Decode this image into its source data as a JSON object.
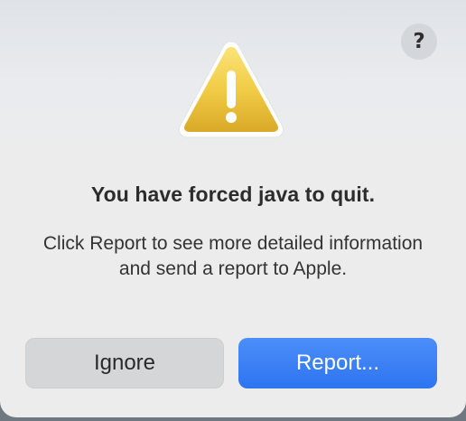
{
  "dialog": {
    "title": "You have forced java to quit.",
    "message": "Click Report to see more detailed information and send a report to Apple.",
    "help_label": "?",
    "icon": "warning-triangle-icon"
  },
  "buttons": {
    "ignore_label": "Ignore",
    "report_label": "Report..."
  },
  "colors": {
    "accent": "#2d74f0",
    "warning_yellow": "#f0c93a",
    "background": "#ececec"
  }
}
